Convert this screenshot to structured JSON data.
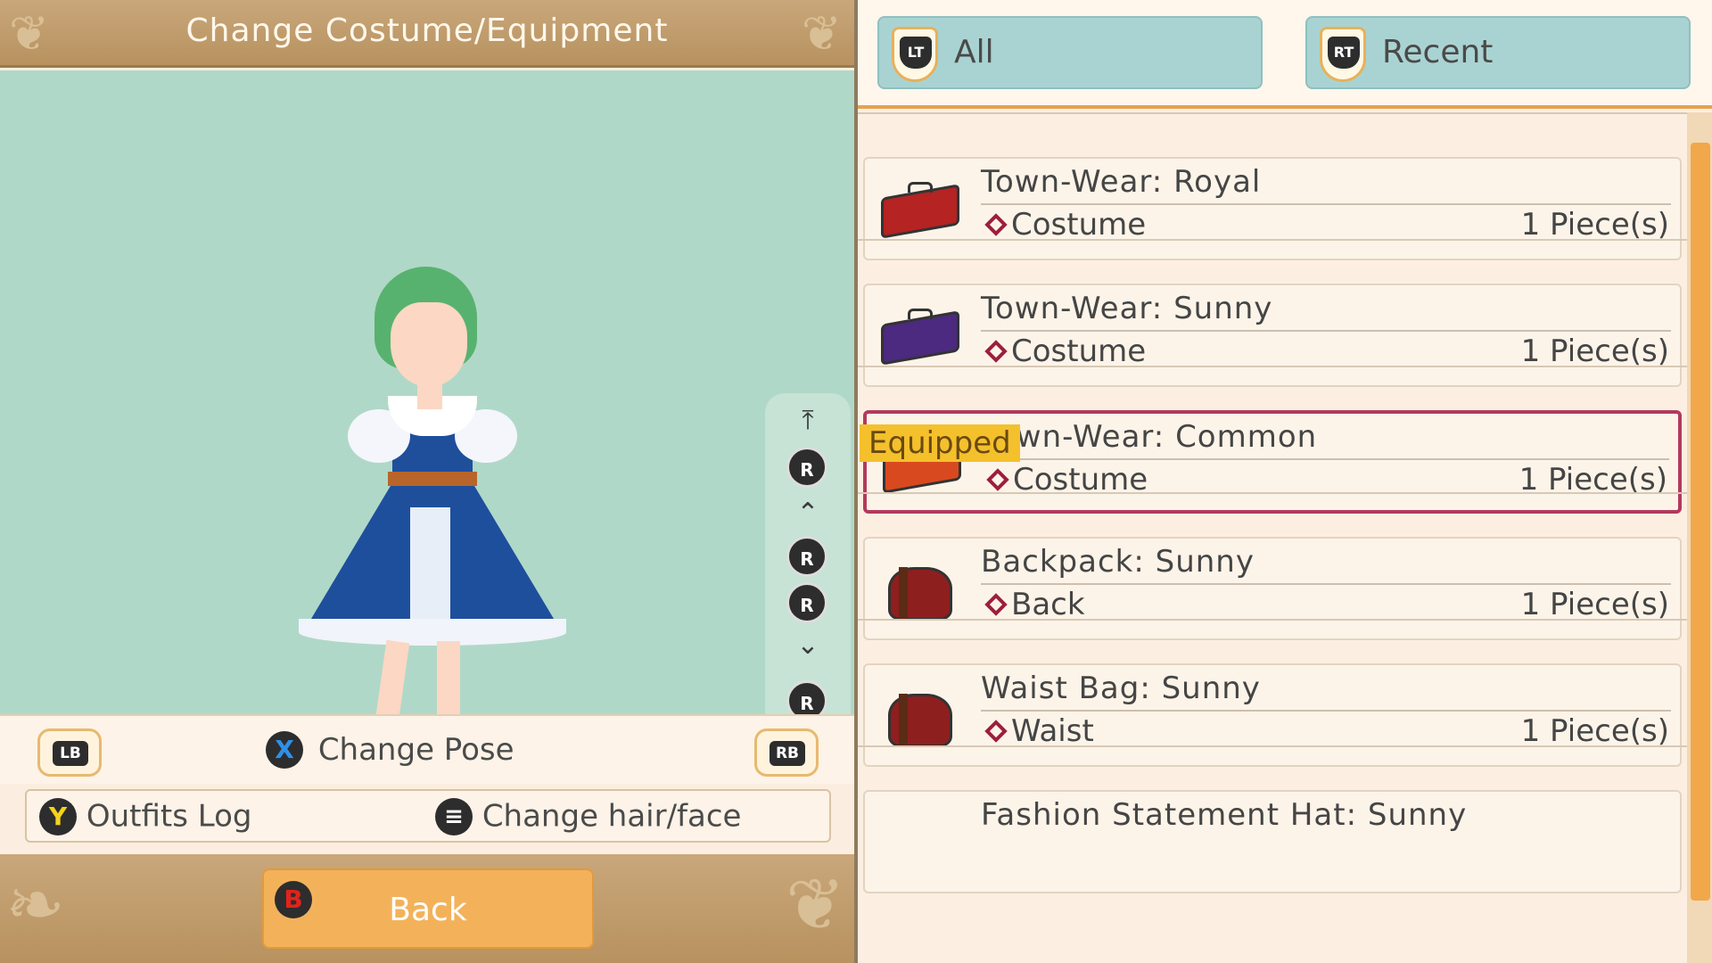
{
  "header": {
    "title": "Change Costume/Equipment"
  },
  "controls": {
    "lb": "LB",
    "rb": "RB",
    "x_glyph": "X",
    "change_pose": "Change Pose",
    "y_glyph": "Y",
    "outfits_log": "Outfits Log",
    "change_hair_face": "Change hair/face",
    "b_glyph": "B",
    "back": "Back"
  },
  "rotation": {
    "r_label": "R"
  },
  "tabs": [
    {
      "key": "LT",
      "label": "All"
    },
    {
      "key": "RT",
      "label": "Recent"
    }
  ],
  "equipped_label": "Equipped",
  "items": [
    {
      "name": "Town-Wear: Royal",
      "type": "Costume",
      "qty": "1 Piece(s)",
      "icon": "suitcase-red-icon",
      "color": "#b52323"
    },
    {
      "name": "Town-Wear: Sunny",
      "type": "Costume",
      "qty": "1 Piece(s)",
      "icon": "suitcase-purple-icon",
      "color": "#4b2a7f"
    },
    {
      "name": "Town-Wear: Common",
      "type": "Costume",
      "qty": "1 Piece(s)",
      "icon": "suitcase-orange-icon",
      "color": "#d9491f",
      "equipped": true
    },
    {
      "name": "Backpack: Sunny",
      "type": "Back",
      "qty": "1 Piece(s)",
      "icon": "backpack-icon",
      "color": "#8e1f1f"
    },
    {
      "name": "Waist Bag: Sunny",
      "type": "Waist",
      "qty": "1 Piece(s)",
      "icon": "waist-bag-icon",
      "color": "#8e1f1f"
    },
    {
      "name": "Fashion Statement Hat: Sunny",
      "type": "",
      "qty": "",
      "icon": "hat-icon",
      "color": "#8e1f1f"
    }
  ],
  "colors": {
    "accent_orange": "#f3b25a",
    "equipped_border": "#b23a5d",
    "tab_bg": "#a9d3d2",
    "preview_bg": "#b0d8c8"
  }
}
